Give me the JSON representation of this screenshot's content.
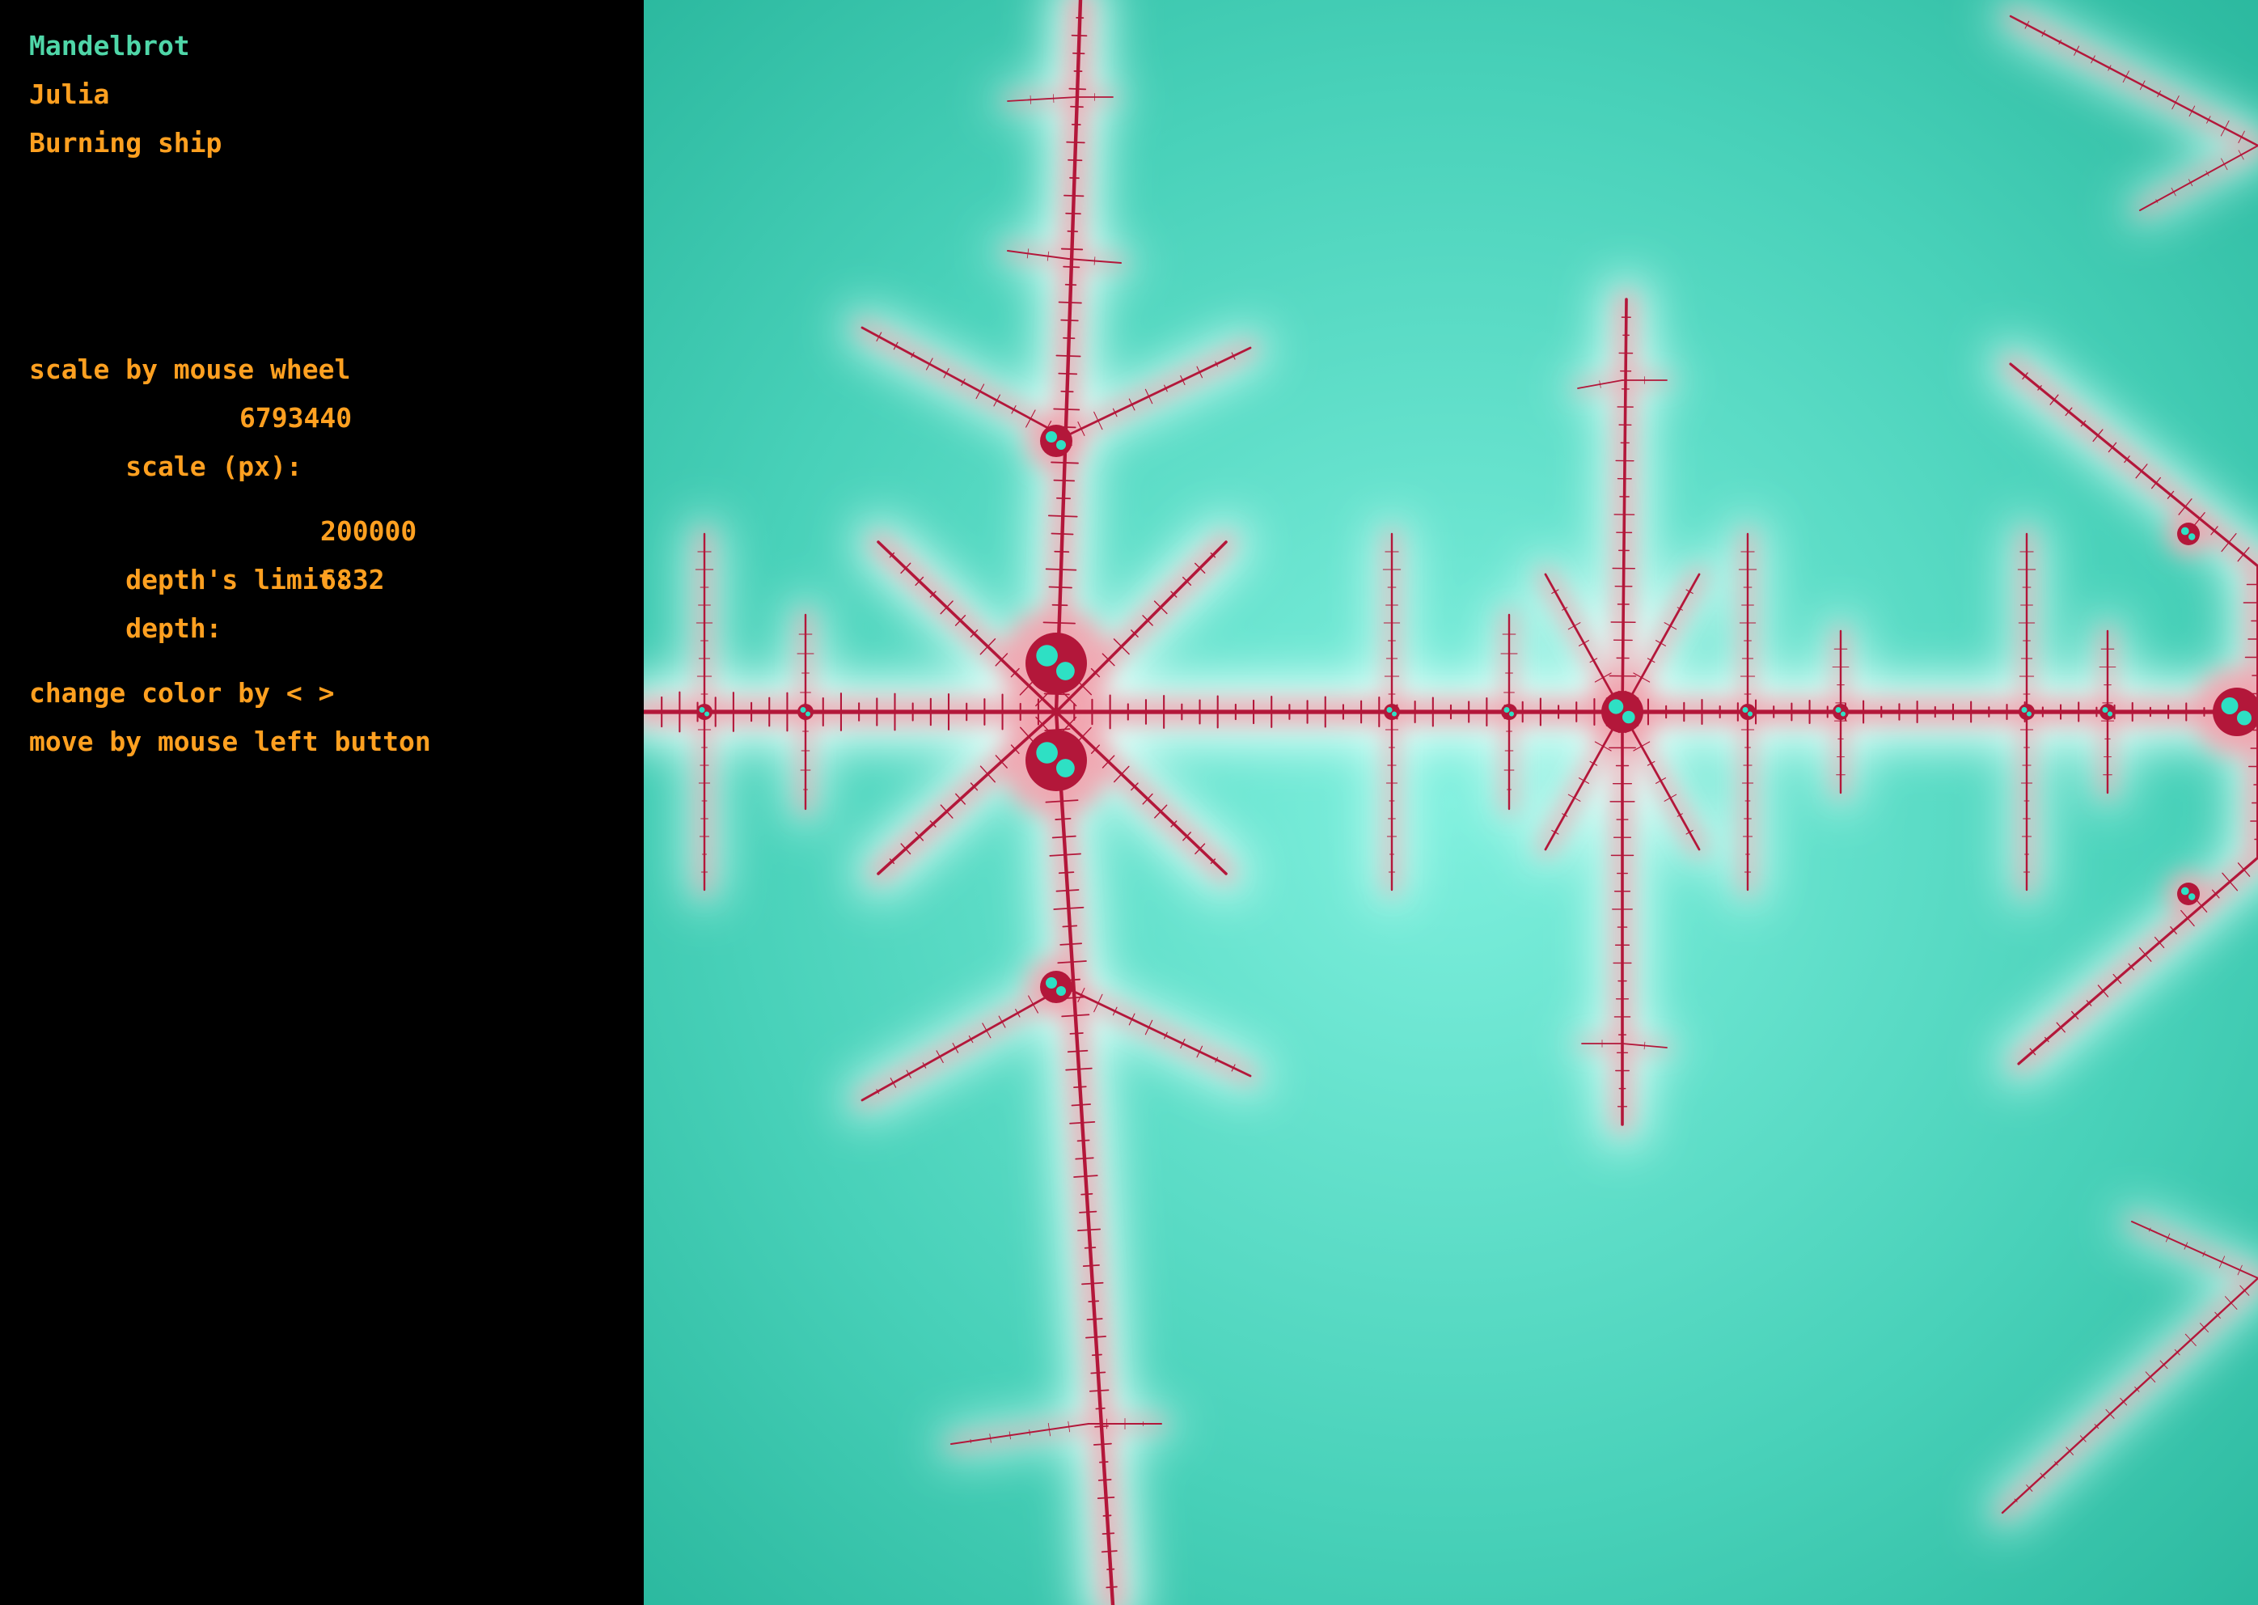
{
  "fractals": [
    {
      "label": "Mandelbrot",
      "active": true
    },
    {
      "label": "Julia",
      "active": false
    },
    {
      "label": "Burning ship",
      "active": false
    }
  ],
  "info": {
    "scale_hint": "scale by mouse wheel",
    "scale_label": "scale (px):",
    "scale_value": "6793440",
    "depth_limit_label": "depth's limit:",
    "depth_limit_value": "200000",
    "depth_label": "depth:",
    "depth_value": "6832",
    "color_hint": "change color by < >",
    "move_hint": "move by mouse left button"
  },
  "colors": {
    "active": "#4fd6a8",
    "accent": "#ffa020",
    "sidebar_bg": "#000000",
    "fractal_bg": "#2fbfa4",
    "fractal_glow": "#e6fffb",
    "fractal_halo": "#f2a3ae",
    "fractal_core": "#b3173a",
    "fractal_spark": "#2ee0c4"
  }
}
